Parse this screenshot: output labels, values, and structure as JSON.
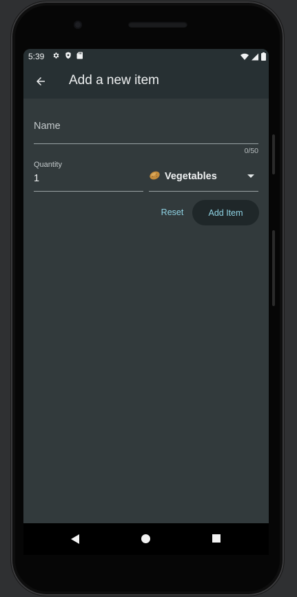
{
  "status_bar": {
    "time": "5:39",
    "left_icons": [
      "gear-icon",
      "shield-icon",
      "sd-card-icon"
    ],
    "right_icons": [
      "wifi-icon",
      "signal-icon",
      "battery-icon"
    ]
  },
  "app_bar": {
    "back_icon": "arrow-left-icon",
    "title": "Add a new item"
  },
  "form": {
    "name_label": "Name",
    "name_counter": "0/50",
    "quantity_label": "Quantity",
    "quantity_value": "1",
    "category_icon": "potato-icon",
    "category_value": "Vegetables",
    "reset_label": "Reset",
    "add_label": "Add Item"
  },
  "colors": {
    "screen_background": "#323a3c",
    "app_bar_background": "#273033",
    "accent": "#8fd3e4",
    "add_button_background": "#1f2729"
  },
  "nav_bar": {
    "icons": [
      "triangle-back-icon",
      "circle-home-icon",
      "square-recents-icon"
    ]
  }
}
